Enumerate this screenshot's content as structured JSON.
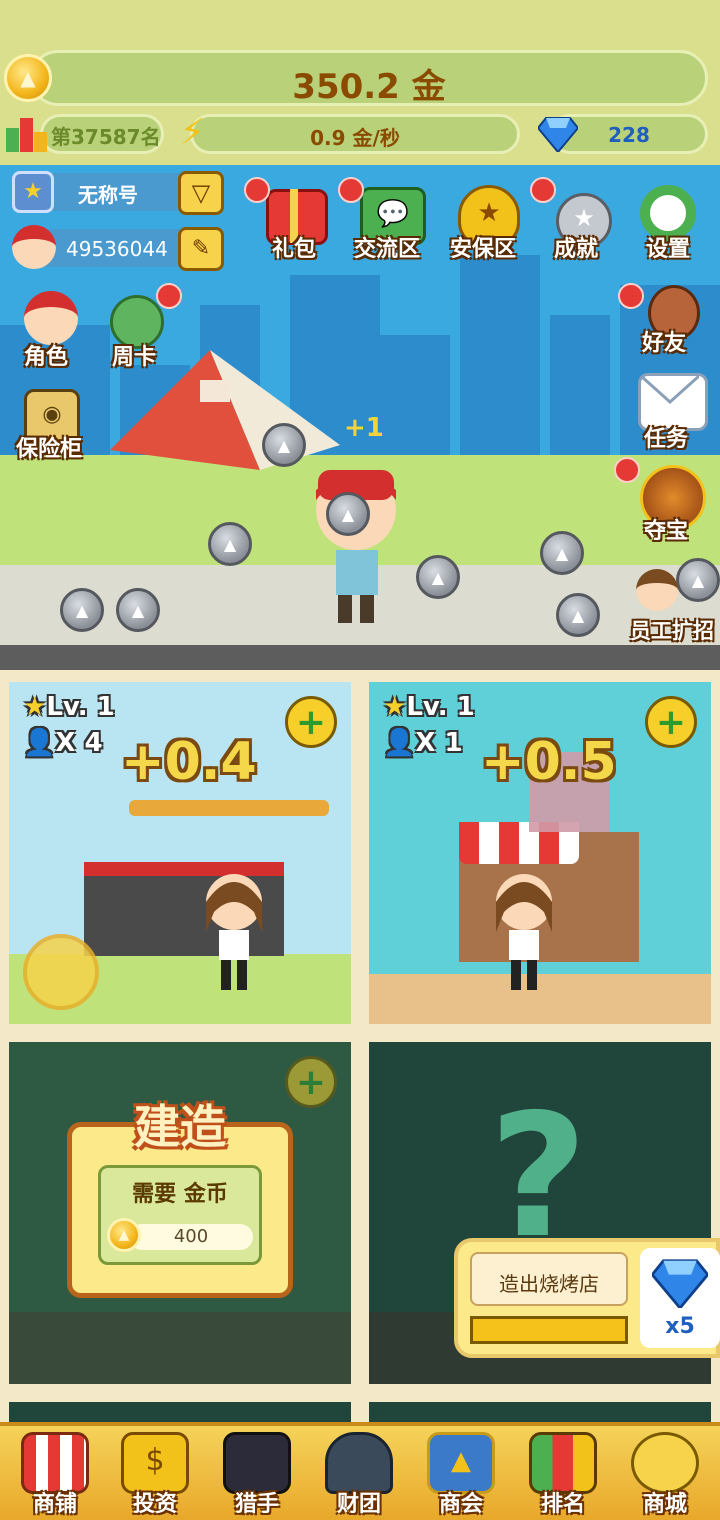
{
  "top": {
    "gold_amount": "350.2 金",
    "rank_text": "第37587名",
    "income_rate": "0.9 金/秒",
    "gems": "228"
  },
  "profile": {
    "nickname": "无称号",
    "player_id": "49536044"
  },
  "top_icons": [
    {
      "label": "礼包",
      "badge": true
    },
    {
      "label": "交流区",
      "badge": true
    },
    {
      "label": "安保区",
      "badge": false
    },
    {
      "label": "成就",
      "badge": true
    },
    {
      "label": "设置",
      "badge": false
    }
  ],
  "left_icons": [
    {
      "label": "角色"
    },
    {
      "label": "周卡"
    },
    {
      "label": "保险柜"
    }
  ],
  "right_icons": [
    {
      "label": "好友"
    },
    {
      "label": "任务"
    },
    {
      "label": "夺宝"
    },
    {
      "label": "员工扩招"
    }
  ],
  "scene": {
    "floating_bonus": "+1"
  },
  "shops": [
    {
      "level": "Lv. 1",
      "staff": "X 4",
      "income": "+0.4"
    },
    {
      "level": "Lv. 1",
      "staff": "X 1",
      "income": "+0.5"
    }
  ],
  "build": {
    "title": "建造",
    "need_label": "需要 金币",
    "cost": "400"
  },
  "mystery": {
    "goal_label": "造出烧烤店",
    "reward": "x5"
  },
  "bottom_nav": [
    {
      "label": "商铺"
    },
    {
      "label": "投资"
    },
    {
      "label": "猎手"
    },
    {
      "label": "财团"
    },
    {
      "label": "商会"
    },
    {
      "label": "排名"
    },
    {
      "label": "商城"
    }
  ],
  "colors": {
    "accent_gold": "#f3b51a",
    "badge_red": "#e53935",
    "gem_blue": "#2f86e8"
  }
}
